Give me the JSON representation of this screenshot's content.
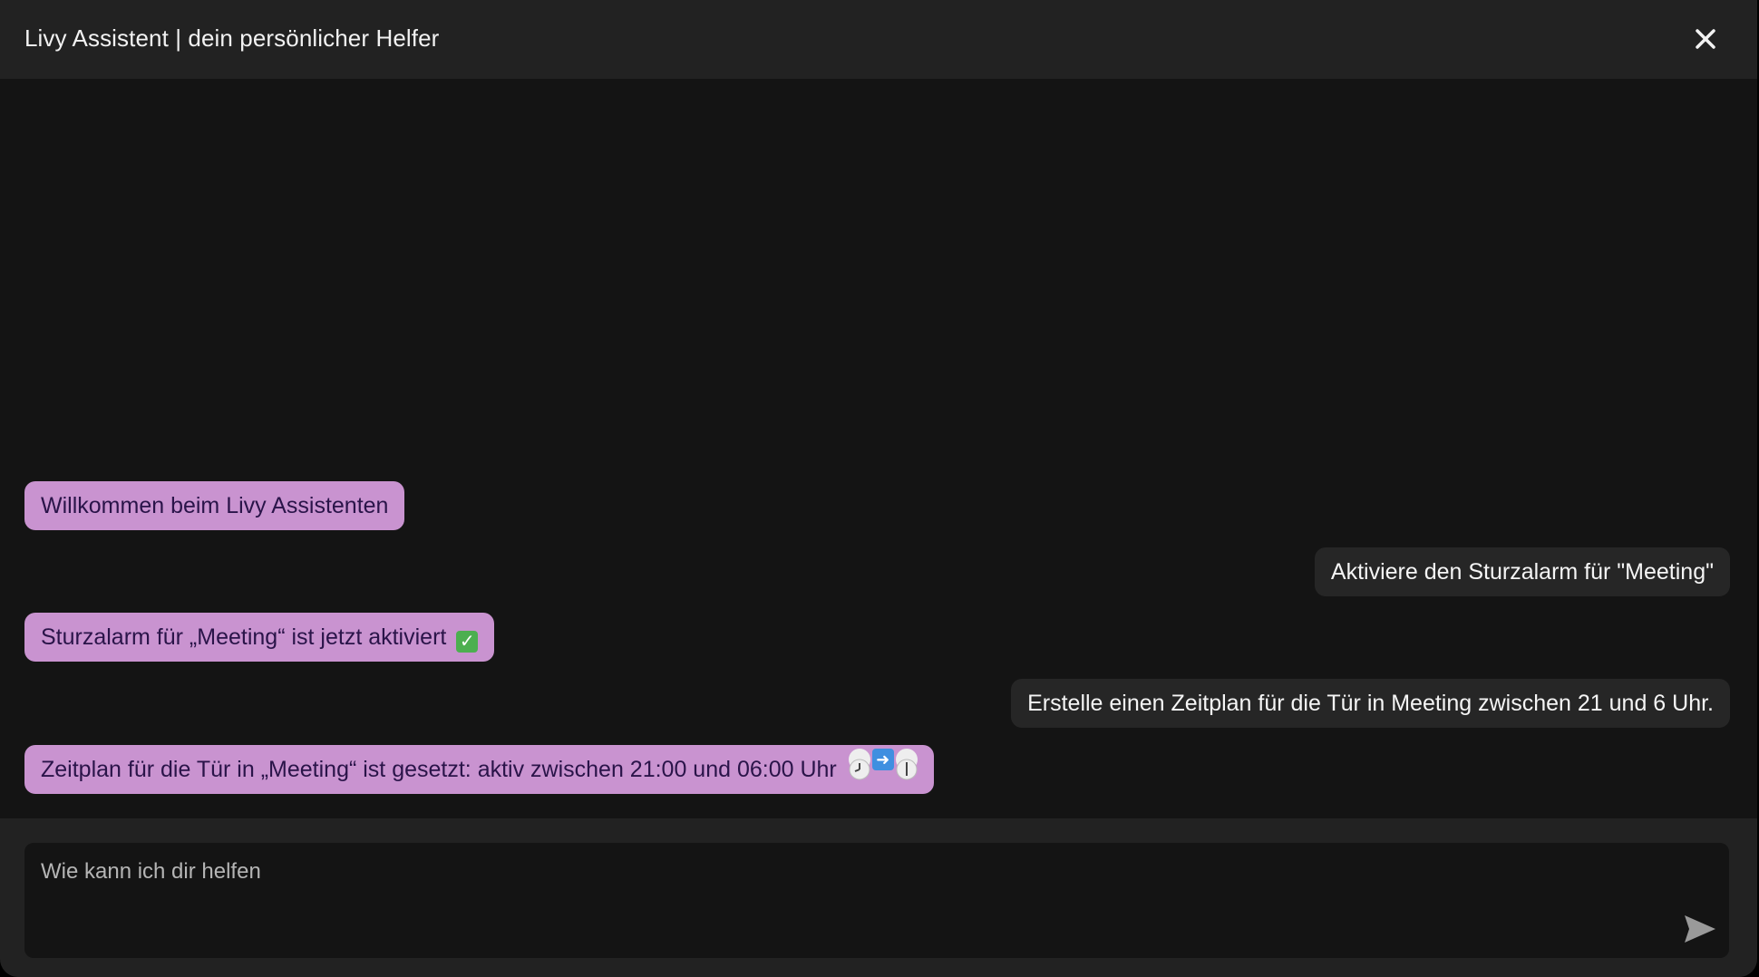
{
  "header": {
    "title": "Livy Assistent | dein persönlicher Helfer",
    "close_icon": "close-icon"
  },
  "messages": [
    {
      "role": "bot",
      "text": "Willkommen beim Livy Assistenten"
    },
    {
      "role": "user",
      "text": "Aktiviere den Sturzalarm für \"Meeting\""
    },
    {
      "role": "bot",
      "text": "Sturzalarm für „Meeting“ ist jetzt aktiviert",
      "emoji": "check-mark-icon"
    },
    {
      "role": "user",
      "text": "Erstelle einen Zeitplan für die Tür in Meeting zwischen 21 und 6 Uhr."
    },
    {
      "role": "bot",
      "text": "Zeitplan für die Tür in „Meeting“ ist gesetzt: aktiv zwischen 21:00 und 06:00 Uhr",
      "emoji": "clock-arrow-clock-icons"
    }
  ],
  "composer": {
    "placeholder": "Wie kann ich dir helfen",
    "value": "",
    "send_icon": "send-icon"
  },
  "colors": {
    "bot_bubble": "#c993d0",
    "bot_text": "#2a1449",
    "user_bubble": "#262626",
    "background": "#141414",
    "header": "#222222"
  }
}
